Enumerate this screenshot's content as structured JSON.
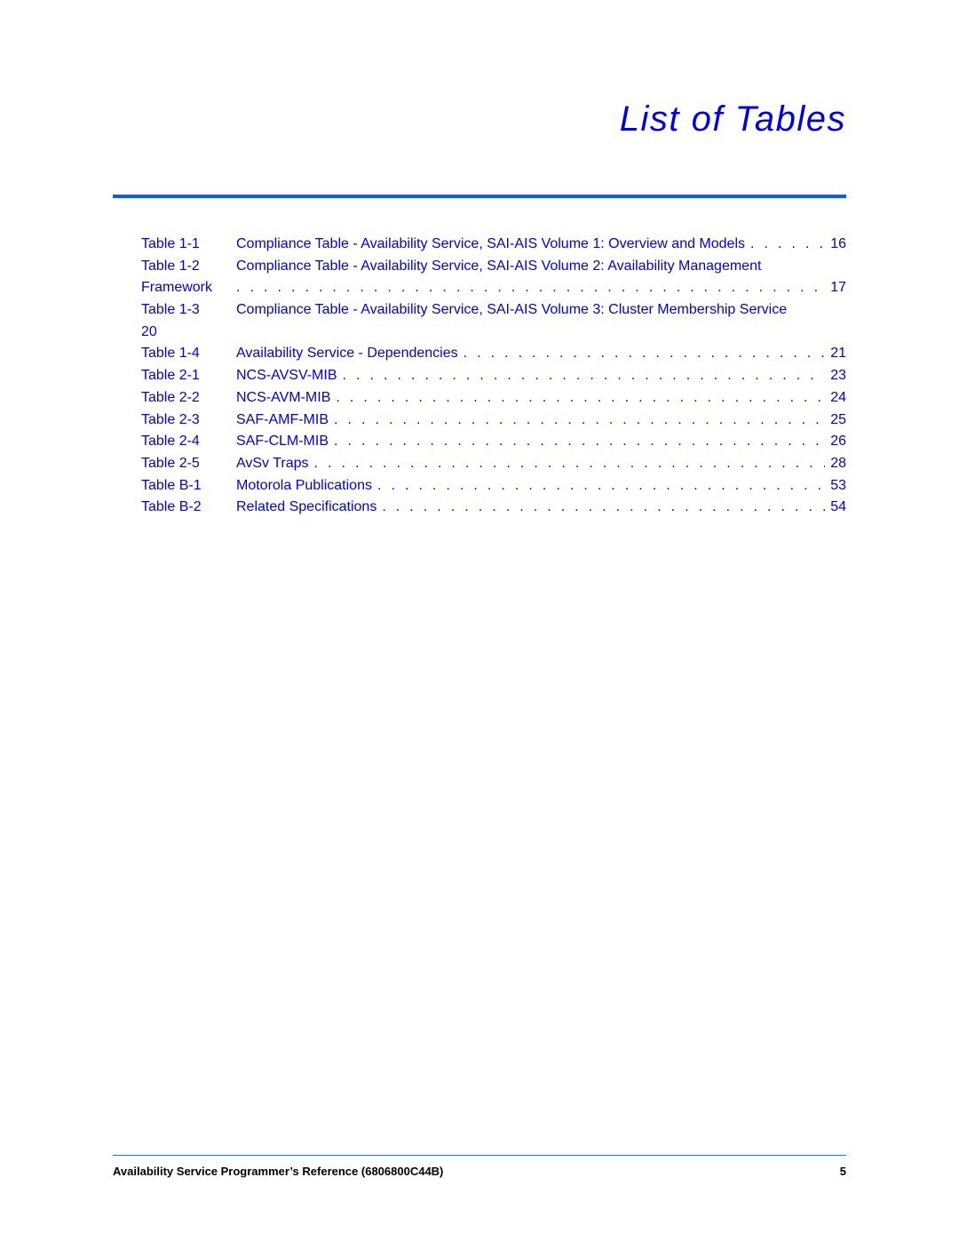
{
  "page": {
    "title": "List of Tables",
    "accent_color": "#0000e6",
    "rule_color": "#0a5cf5"
  },
  "toc": {
    "entries": [
      {
        "label": "Table 1-1",
        "text": "Compliance Table - Availability Service, SAI-AIS Volume 1: Overview and Models",
        "page": "16"
      },
      {
        "label": "Table 1-2",
        "text": "Compliance Table - Availability Service, SAI-AIS Volume 2: Availability Management",
        "wrap_label": "Framework",
        "page": "17"
      },
      {
        "label": "Table 1-3",
        "text": "Compliance Table - Availability Service, SAI-AIS Volume 3: Cluster Membership Service",
        "wrap_label": "20",
        "page": ""
      },
      {
        "label": "Table 1-4",
        "text": "Availability Service - Dependencies",
        "page": "21"
      },
      {
        "label": "Table 2-1",
        "text": "NCS-AVSV-MIB",
        "page": "23"
      },
      {
        "label": "Table 2-2",
        "text": "NCS-AVM-MIB",
        "page": "24"
      },
      {
        "label": "Table 2-3",
        "text": "SAF-AMF-MIB",
        "page": "25"
      },
      {
        "label": "Table 2-4",
        "text": "SAF-CLM-MIB",
        "page": "26"
      },
      {
        "label": "Table 2-5",
        "text": "AvSv Traps",
        "page": "28"
      },
      {
        "label": "Table B-1",
        "text": "Motorola Publications",
        "page": "53"
      },
      {
        "label": "Table B-2",
        "text": "Related Specifications",
        "page": "54"
      }
    ]
  },
  "footer": {
    "document_title": "Availability Service Programmer’s Reference (6806800C44B)",
    "page_number": "5"
  }
}
